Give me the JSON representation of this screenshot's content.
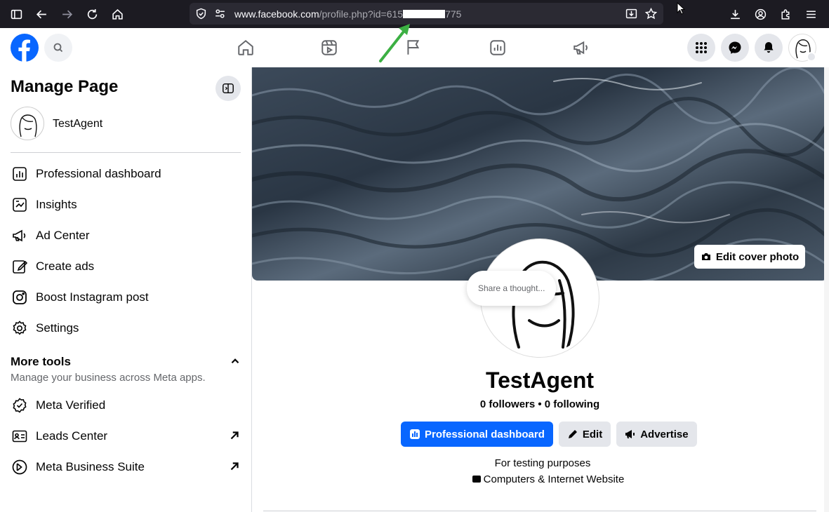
{
  "browser": {
    "url_host": "www.facebook.com",
    "url_path_prefix": "/profile.php?id=615",
    "url_path_suffix": "775"
  },
  "nav": {
    "icons": [
      "home-icon",
      "video-icon",
      "pages-flag-icon",
      "dashboard-icon",
      "ads-megaphone-icon"
    ]
  },
  "sidebar": {
    "title": "Manage Page",
    "profile_name": "TestAgent",
    "items": [
      {
        "label": "Professional dashboard",
        "icon": "dashboard-icon"
      },
      {
        "label": "Insights",
        "icon": "insights-icon"
      },
      {
        "label": "Ad Center",
        "icon": "megaphone-icon"
      },
      {
        "label": "Create ads",
        "icon": "pencil-icon"
      },
      {
        "label": "Boost Instagram post",
        "icon": "instagram-icon"
      },
      {
        "label": "Settings",
        "icon": "gear-icon"
      }
    ],
    "more_tools": {
      "title": "More tools",
      "subtitle": "Manage your business across Meta apps.",
      "items": [
        {
          "label": "Meta Verified",
          "icon": "verified-icon"
        },
        {
          "label": "Leads Center",
          "icon": "leads-icon"
        },
        {
          "label": "Meta Business Suite",
          "icon": "business-suite-icon"
        }
      ]
    }
  },
  "main": {
    "edit_cover_label": "Edit cover photo",
    "thought_placeholder": "Share a thought...",
    "name": "TestAgent",
    "follow_text": "0 followers • 0 following",
    "buttons": {
      "dashboard": "Professional dashboard",
      "edit": "Edit",
      "advertise": "Advertise"
    },
    "bio": "For testing purposes",
    "category": "Computers & Internet Website"
  },
  "colors": {
    "brand": "#0866ff",
    "annotation_arrow": "#3cb043"
  }
}
